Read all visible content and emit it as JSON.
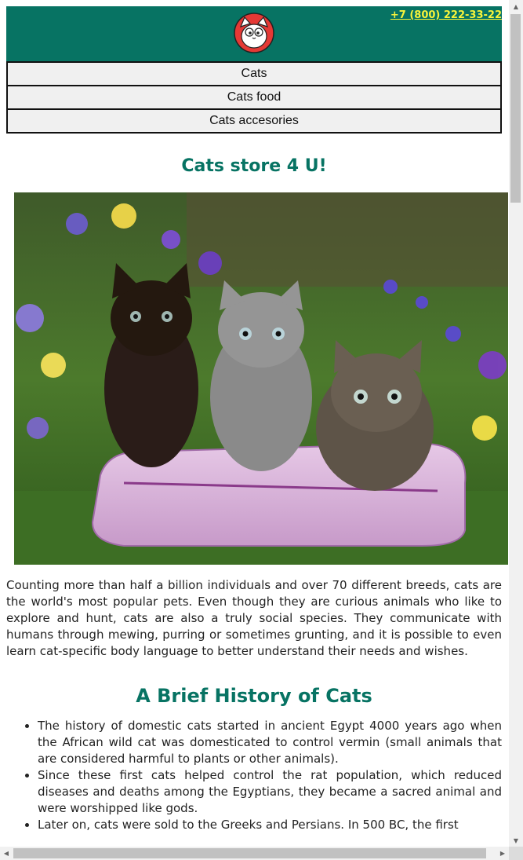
{
  "header": {
    "phone": "+7 (800) 222-33-22",
    "logo_icon": "cat-face-icon",
    "background": "#077363",
    "phone_color": "#f7f33a"
  },
  "nav": {
    "items": [
      {
        "label": "Cats"
      },
      {
        "label": "Cats food"
      },
      {
        "label": "Cats accesories"
      }
    ]
  },
  "main": {
    "title": "Cats store 4 U!",
    "hero_image": "kittens-on-pillow-photo",
    "intro": "Counting more than half a billion individuals and over 70 different breeds, cats are the world's most popular pets. Even though they are curious animals who like to explore and hunt, cats are also a truly social species. They communicate with humans through mewing, purring or sometimes grunting, and it is possible to even learn cat-specific body language to better understand their needs and wishes.",
    "history_title": "A Brief History of Cats",
    "history": [
      "The history of domestic cats started in ancient Egypt 4000 years ago when the African wild cat was domesticated to control vermin (small animals that are considered harmful to plants or other animals).",
      "Since these first cats helped control the rat population, which reduced diseases and deaths among the Egyptians, they became a sacred animal and were worshipped like gods.",
      "Later on, cats were sold to the Greeks and Persians. In 500 BC, the first"
    ]
  },
  "colors": {
    "accent": "#077363"
  }
}
